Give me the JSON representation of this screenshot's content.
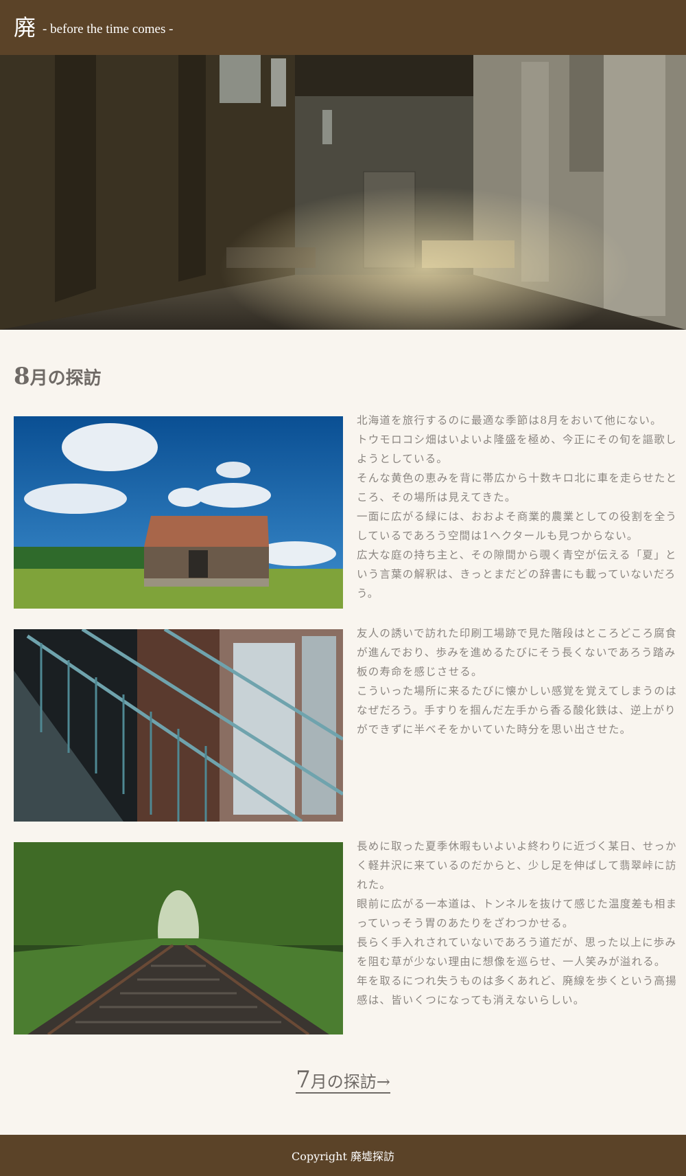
{
  "header": {
    "logo_kanji": "廃",
    "logo_subtitle": "- before the time comes -"
  },
  "hero": {
    "icon": "abandoned-factory-interior-photo"
  },
  "section": {
    "month_num": "8",
    "month_suffix": "月の探訪"
  },
  "articles": [
    {
      "image": "barn-in-field-photo",
      "paragraphs": [
        "北海道を旅行するのに最適な季節は8月をおいて他にない。",
        "トウモロコシ畑はいよいよ隆盛を極め、今正にその旬を謳歌しようとしている。",
        "そんな黄色の恵みを背に帯広から十数キロ北に車を走らせたところ、その場所は見えてきた。",
        "一面に広がる緑には、おおよそ商業的農業としての役割を全うしているであろう空間は1ヘクタールも見つからない。",
        "広大な庭の持ち主と、その隙間から覗く青空が伝える「夏」という言葉の解釈は、きっとまだどの辞書にも載っていないだろう。"
      ]
    },
    {
      "image": "rusty-staircase-photo",
      "paragraphs": [
        "友人の誘いで訪れた印刷工場跡で見た階段はところどころ腐食が進んでおり、歩みを進めるたびにそう長くないであろう踏み板の寿命を感じさせる。",
        "こういった場所に来るたびに懐かしい感覚を覚えてしまうのはなぜだろう。手すりを掴んだ左手から香る酸化鉄は、逆上がりができずに半べそをかいていた時分を思い出させた。"
      ]
    },
    {
      "image": "abandoned-railway-photo",
      "paragraphs": [
        "長めに取った夏季休暇もいよいよ終わりに近づく某日、せっかく軽井沢に来ているのだからと、少し足を伸ばして翡翠峠に訪れた。",
        "眼前に広がる一本道は、トンネルを抜けて感じた温度差も相まっていっそう胃のあたりをざわつかせる。",
        "長らく手入れされていないであろう道だが、思った以上に歩みを阻む草が少ない理由に想像を巡らせ、一人笑みが溢れる。",
        "年を取るにつれ失うものは多くあれど、廃線を歩くという高揚感は、皆いくつになっても消えないらしい。"
      ]
    }
  ],
  "pager": {
    "num": "7",
    "label": "月の探訪→"
  },
  "footer": {
    "copyright": "Copyright 廃墟探訪"
  },
  "colors": {
    "brand_brown": "#5b4328",
    "background": "#f9f5ef",
    "text": "#8a8580"
  }
}
